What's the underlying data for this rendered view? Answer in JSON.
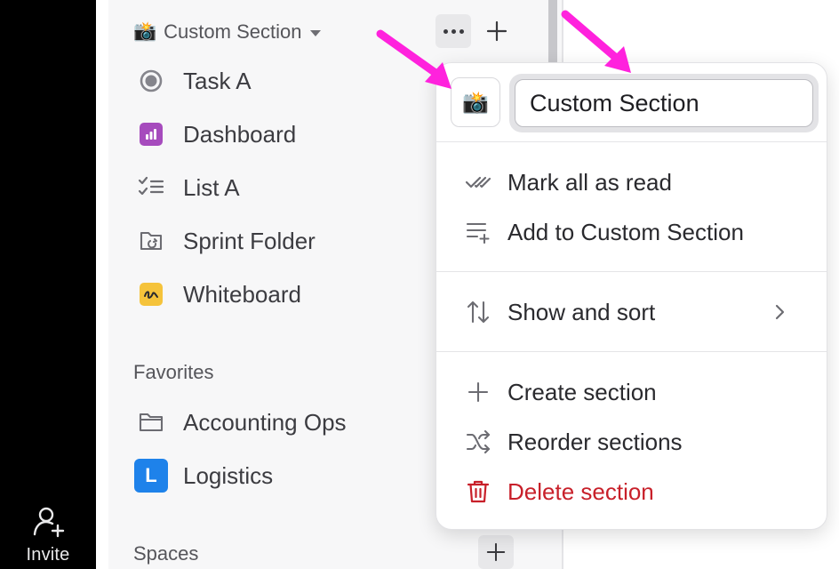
{
  "rail": {
    "invite_label": "Invite"
  },
  "section": {
    "emoji": "📸",
    "title": "Custom Section"
  },
  "nav_items": [
    {
      "label": "Task A",
      "icon": "radio-circle-icon"
    },
    {
      "label": "Dashboard",
      "icon": "dashboard-icon"
    },
    {
      "label": "List A",
      "icon": "checklist-icon"
    },
    {
      "label": "Sprint Folder",
      "icon": "sprint-folder-icon"
    },
    {
      "label": "Whiteboard",
      "icon": "whiteboard-icon"
    }
  ],
  "favorites": {
    "label": "Favorites",
    "items": [
      {
        "label": "Accounting Ops",
        "icon": "folder-icon"
      },
      {
        "label": "Logistics",
        "icon": "space-avatar-icon",
        "avatar_letter": "L"
      }
    ]
  },
  "spaces": {
    "label": "Spaces"
  },
  "menu": {
    "emoji": "📸",
    "name_value": "Custom Section",
    "items": {
      "mark_read": "Mark all as read",
      "add_to": "Add to Custom Section",
      "show_sort": "Show and sort",
      "create": "Create section",
      "reorder": "Reorder sections",
      "delete": "Delete section"
    }
  },
  "colors": {
    "dashboard": "#a64bbd",
    "whiteboard": "#f5c33b",
    "logistics": "#1e82ea",
    "danger": "#c8202a",
    "annotation": "#ff22dd"
  }
}
